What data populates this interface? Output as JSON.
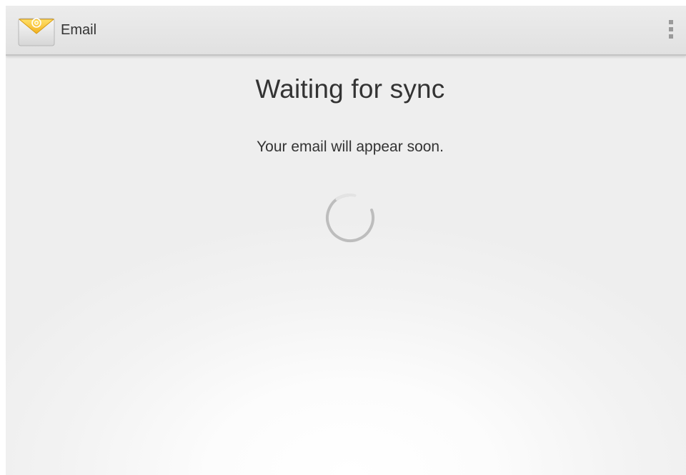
{
  "app": {
    "title": "Email",
    "icon": "email-envelope-icon",
    "menu_icon": "overflow-menu-icon"
  },
  "sync": {
    "title": "Waiting for sync",
    "message": "Your email will appear soon.",
    "indicator": "loading-spinner-icon"
  },
  "colors": {
    "action_bar": "#e6e6e6",
    "text": "#333333",
    "spinner": "#9e9e9e",
    "icon_accent": "#f4c430"
  }
}
